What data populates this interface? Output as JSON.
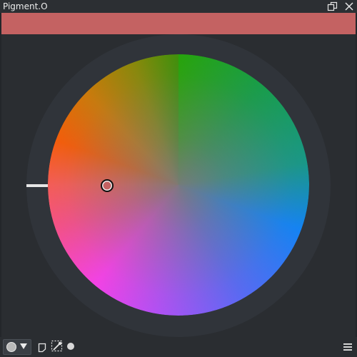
{
  "window": {
    "title": "Pigment.O"
  },
  "colors": {
    "current_color": "#c46262",
    "background": "#23262a",
    "panel": "#2a2d31",
    "ring": "#30343a"
  },
  "wheel": {
    "type": "hue-saturation-wheel",
    "selected_color": "#c46262"
  },
  "bottombar": {
    "selector_icon": "circle-mode-icon",
    "tools": [
      "note-icon",
      "eyedropper-icon",
      "dot-icon"
    ],
    "menu_icon": "hamburger-menu-icon"
  }
}
